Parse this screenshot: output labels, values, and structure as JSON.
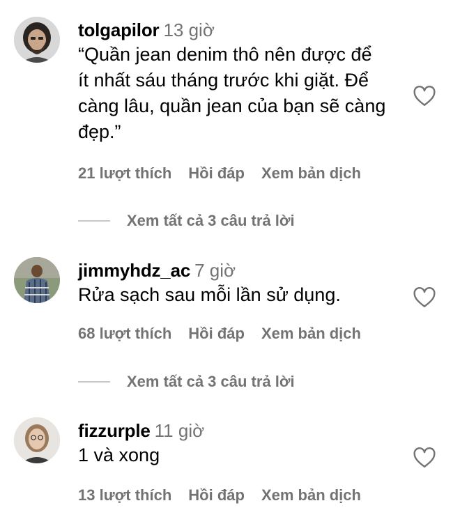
{
  "comments": [
    {
      "username": "tolgapilor",
      "time": "13 giờ",
      "text_lines": [
        "“Quần jean denim thô nên được để",
        "ít nhất sáu tháng trước khi giặt. Để",
        "càng lâu, quần jean của bạn sẽ càng",
        "đẹp.”"
      ],
      "likes": "21 lượt thích",
      "reply": "Hồi đáp",
      "translate": "Xem bản dịch",
      "view_replies": "Xem tất cả 3 câu trả lời",
      "avatar_icon": "avatar-bearded-man"
    },
    {
      "username": "jimmyhdz_ac",
      "time": "7 giờ",
      "text_lines": [
        "Rửa sạch sau mỗi lần sử dụng."
      ],
      "likes": "68 lượt thích",
      "reply": "Hồi đáp",
      "translate": "Xem bản dịch",
      "view_replies": "Xem tất cả 3 câu trả lời",
      "avatar_icon": "avatar-man-plaid-shirt"
    },
    {
      "username": "fizzurple",
      "time": "11 giờ",
      "text_lines": [
        "1 và xong"
      ],
      "likes": "13 lượt thích",
      "reply": "Hồi đáp",
      "translate": "Xem bản dịch",
      "avatar_icon": "avatar-woman-glasses"
    }
  ],
  "colors": {
    "secondary_text": "#737373",
    "divider": "#c7c7c7",
    "primary_text": "#000000"
  },
  "icons": {
    "like": "heart-outline-icon"
  }
}
